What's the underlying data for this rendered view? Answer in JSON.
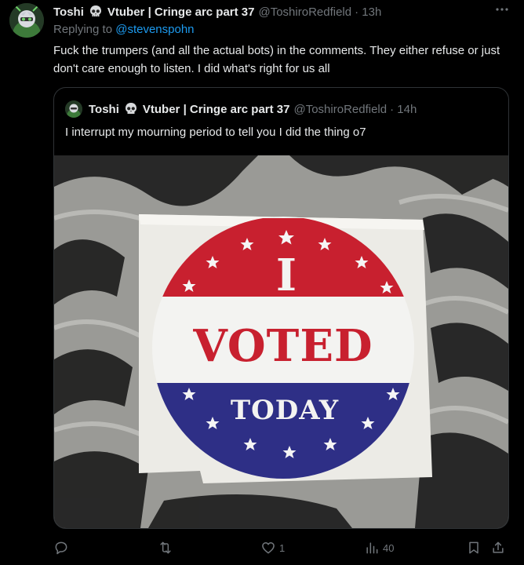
{
  "tweet": {
    "author_name": "Toshi",
    "author_name_suffix": "Vtuber | Cringe arc part 37",
    "handle": "@ToshiroRedfield",
    "time": "· 13h",
    "replying_prefix": "Replying to",
    "replying_to": "@stevenspohn",
    "text": "Fuck the trumpers (and all the actual bots) in the comments. They either refuse or just don't care enough to listen. I did what's right for us all"
  },
  "quote": {
    "author_name": "Toshi",
    "author_name_suffix": "Vtuber | Cringe arc part 37",
    "handle": "@ToshiroRedfield",
    "time": "· 14h",
    "text": "I interrupt my mourning period to tell you I did the thing o7",
    "sticker": {
      "line1": "I",
      "line2": "VOTED",
      "line3": "TODAY"
    }
  },
  "actions": {
    "reply_count": "",
    "retweet_count": "",
    "like_count": "1",
    "view_count": "40"
  },
  "colors": {
    "accent": "#1d9bf0",
    "muted": "#71767b",
    "text": "#e7e9ea",
    "sticker_red": "#c8202f",
    "sticker_blue": "#2e2f86"
  },
  "icons": [
    "skull-icon",
    "more-icon",
    "reply-icon",
    "retweet-icon",
    "like-icon",
    "views-icon",
    "bookmark-icon",
    "share-icon"
  ]
}
